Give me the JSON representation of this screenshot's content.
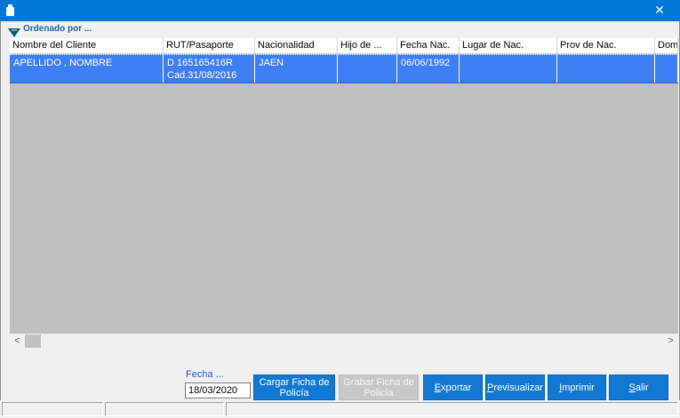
{
  "window": {
    "close_glyph": "✕"
  },
  "sort": {
    "label": "Ordenado por ...",
    "icon": "sort-triangle-icon"
  },
  "grid": {
    "columns": [
      "Nombre del Cliente",
      "RUT/Pasaporte",
      "Nacionalidad",
      "Hijo de ...",
      "Fecha Nac.",
      "Lugar de Nac.",
      "Prov de Nac.",
      "Dom"
    ],
    "rows": [
      [
        "APELLIDO , NOMBRE",
        "D 165165416R\nCad.31/08/2016",
        "JAEN",
        "",
        "06/06/1992",
        "",
        "",
        ""
      ]
    ],
    "selected_color": "#3d7ef5"
  },
  "scroll": {
    "left_glyph": "<",
    "right_glyph": ">"
  },
  "fecha": {
    "label": "Fecha ...",
    "value": "18/03/2020"
  },
  "buttons": {
    "cargar_line1": "Cargar Ficha de",
    "cargar_line2": "Policía",
    "grabar_line1": "Grabar Ficha de",
    "grabar_line2": "Policía",
    "exportar_ul": "E",
    "exportar_rest": "xportar",
    "previsualizar_ul": "P",
    "previsualizar_rest": "revisualizar",
    "imprimir_ul": "I",
    "imprimir_rest": "mprimir",
    "salir_ul": "S",
    "salir_rest": "alir"
  },
  "colors": {
    "titlebar": "#0078d7",
    "button": "#1179d4",
    "grid_background": "#c0c0c0"
  }
}
